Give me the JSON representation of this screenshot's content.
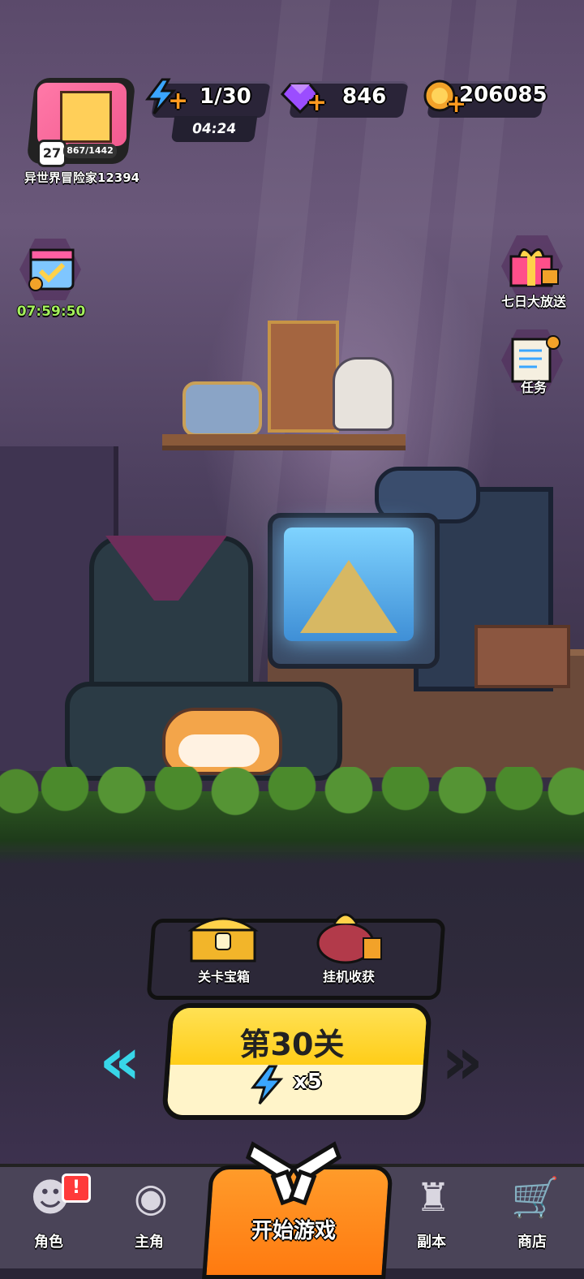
{
  "player": {
    "name": "异世界冒险家12394",
    "level": "27",
    "xp": "867/1442"
  },
  "resources": {
    "energy": "1/30",
    "energy_timer": "04:24",
    "gems": "846",
    "coins": "206085"
  },
  "side": {
    "checkin_timer": "07:59:50",
    "seven_day_label": "七日大放送",
    "tasks_label": "任务"
  },
  "rewards": {
    "chest_label": "关卡宝箱",
    "idle_label": "挂机收获"
  },
  "stage": {
    "title": "第30关",
    "cost": "x5"
  },
  "nav": {
    "characters": "角色",
    "hero": "主角",
    "start": "开始游戏",
    "dungeon": "副本",
    "shop": "商店",
    "badge": "!"
  },
  "colors": {
    "accent_orange": "#ff8a1a",
    "stage_yellow": "#ffd52a",
    "energy_blue": "#3aa6ff",
    "gem_purple": "#9b4dff",
    "coin_gold": "#f2a229",
    "timer_green": "#a4f05c"
  },
  "icons": {
    "energy": "lightning-icon",
    "gem": "gem-icon",
    "coin": "coin-icon",
    "checkin": "calendar-check-icon",
    "gift": "gift-icon",
    "tasks": "scroll-icon",
    "chest": "chest-icon",
    "idle": "loot-bag-icon",
    "prev": "chevron-left-icon",
    "next": "chevron-right-icon",
    "start": "crossed-guns-icon"
  }
}
